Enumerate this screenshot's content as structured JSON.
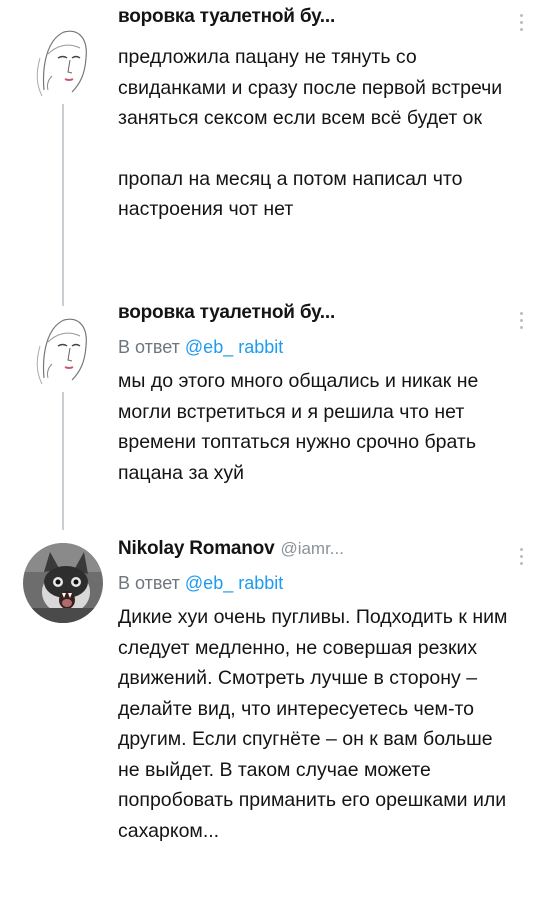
{
  "tweets": [
    {
      "display_name": "воровка туалетной бу...",
      "handle": "",
      "avatar": "sketch-woman-avatar",
      "reply_prefix": "",
      "reply_to": "",
      "paragraphs": [
        "предложила пацану не тянуть со свиданками и сразу после первой встречи заняться сексом если всем всё будет ок",
        "пропал на месяц а потом написал что настроения чот нет"
      ]
    },
    {
      "display_name": "воровка туалетной бу...",
      "handle": "",
      "avatar": "sketch-woman-avatar",
      "reply_prefix": "В ответ",
      "reply_to": "@eb_ rabbit",
      "paragraphs": [
        "мы до этого много общались и никак не могли встретиться и я решила что нет времени топтаться нужно срочно брать пацана за хуй"
      ]
    },
    {
      "display_name": "Nikolay Romanov",
      "handle": "@iamr...",
      "avatar": "cat-photo-avatar",
      "reply_prefix": "В ответ",
      "reply_to": "@eb_ rabbit",
      "paragraphs": [
        "Дикие хуи очень пугливы. Подходить к ним следует медленно, не совершая резких движений. Смотреть лучше в сторону – делайте вид, что интересуетесь чем-то другим. Если спугнёте – он к вам больше не выйдет. В таком случае можете попробовать приманить его орешками или сахарком..."
      ]
    }
  ],
  "colors": {
    "link": "#1d9bf0",
    "muted": "#6e767d",
    "thread_line": "#c9ced3",
    "text": "#141414"
  }
}
